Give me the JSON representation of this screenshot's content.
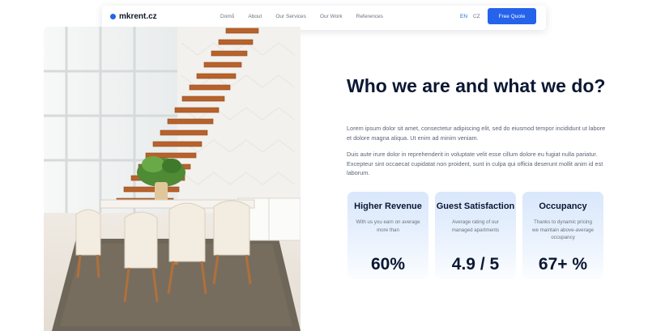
{
  "brand": {
    "name": "mkrent.cz"
  },
  "nav": {
    "items": [
      "Domů",
      "About",
      "Our Services",
      "Our Work",
      "References"
    ],
    "lang_en": "EN",
    "lang_cz": "CZ",
    "cta": "Free Quote"
  },
  "about": {
    "title": "Who we are and what we do?",
    "paragraph1": "Lorem ipsum dolor sit amet, consectetur adipiscing elit, sed do eiusmod tempor incididunt ut labore et dolore magna aliqua. Ut enim ad minim veniam.",
    "paragraph2": "Duis aute irure dolor in reprehenderit in voluptate velit esse cillum dolore eu fugiat nulla pariatur. Excepteur sint occaecat cupidatat non proident, sunt in culpa qui officia deserunt mollit anim id est laborum."
  },
  "stats": [
    {
      "title": "Higher Revenue",
      "desc": "With us you earn on average more than",
      "value": "60%"
    },
    {
      "title": "Guest Satisfaction",
      "desc": "Average rating of our managed apartments",
      "value": "4.9 / 5"
    },
    {
      "title": "Occupancy",
      "desc": "Thanks to dynamic pricing we maintain above-average occupancy",
      "value": "67+ %"
    }
  ],
  "colors": {
    "accent": "#2563eb",
    "heading": "#0b1733",
    "card_bg": "#e4eefc"
  }
}
